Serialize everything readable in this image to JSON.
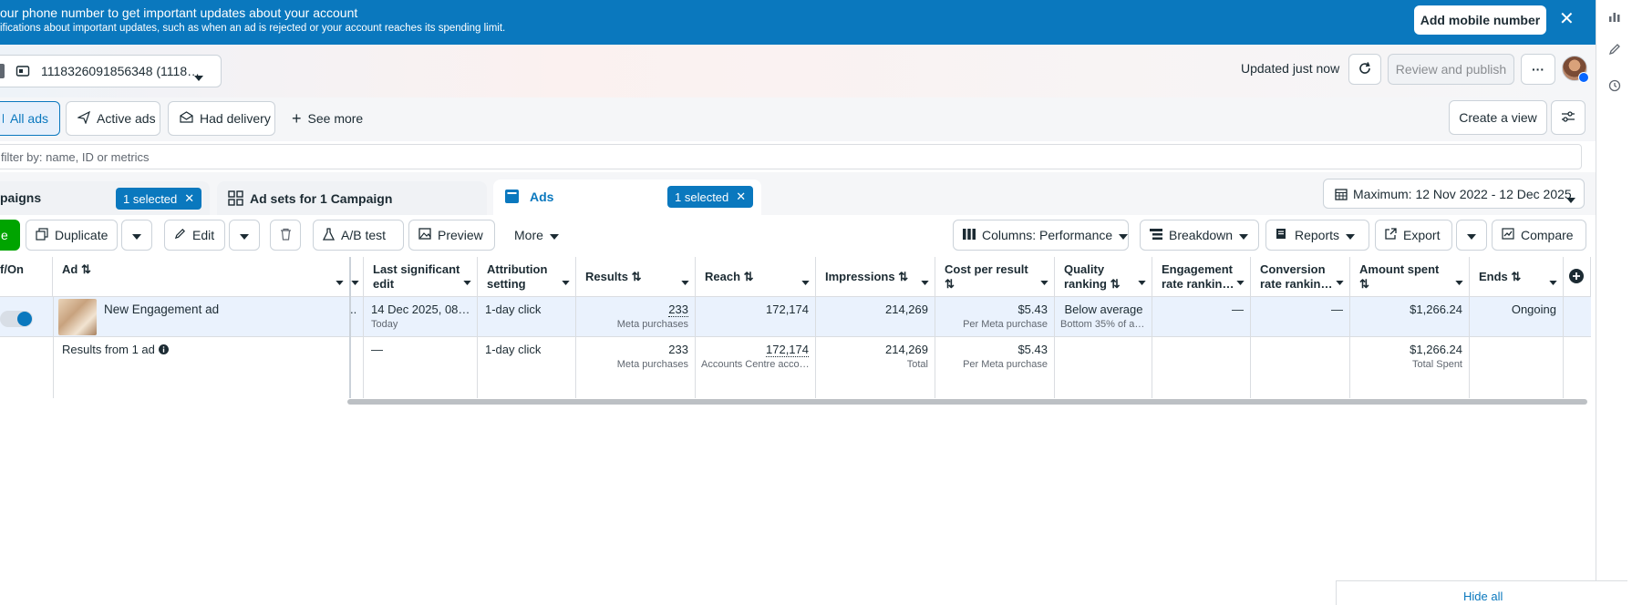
{
  "banner": {
    "line1": "our phone number to get important updates about your account",
    "line2": "ifications about important updates, such as when an ad is rejected or your account reaches its spending limit.",
    "add_button": "Add mobile number",
    "close": "✕"
  },
  "header": {
    "account": "1118326091856348 (1118…",
    "updated": "Updated just now",
    "review_publish": "Review and publish",
    "more": "···"
  },
  "filters": {
    "all_ads": "All ads",
    "active_ads": "Active ads",
    "had_delivery": "Had delivery",
    "see_more": "See more",
    "create_view": "Create a view"
  },
  "search": {
    "placeholder": "filter by: name, ID or metrics"
  },
  "levels": {
    "campaigns": "paigns",
    "campaigns_badge": "1 selected",
    "adsets": "Ad sets for 1 Campaign",
    "ads": "Ads",
    "ads_badge": "1 selected"
  },
  "date_range": "Maximum: 12 Nov 2022 - 12 Dec 2025",
  "toolbar": {
    "create": "e",
    "duplicate": "Duplicate",
    "edit": "Edit",
    "ab_test": "A/B test",
    "preview": "Preview",
    "more": "More",
    "columns": "Columns: Performance",
    "breakdown": "Breakdown",
    "reports": "Reports",
    "export": "Export",
    "compare": "Compare"
  },
  "columns": {
    "offon": "f/On",
    "ad": "Ad",
    "last_edit_1": "Last significant",
    "last_edit_2": "edit",
    "attribution_1": "Attribution",
    "attribution_2": "setting",
    "results": "Results",
    "reach": "Reach",
    "impressions": "Impressions",
    "cpr_1": "Cost per result",
    "quality_1": "Quality",
    "quality_2": "ranking",
    "engagement_1": "Engagement",
    "engagement_2": "rate rankin…",
    "conversion_1": "Conversion",
    "conversion_2": "rate rankin…",
    "amount_spent_1": "Amount spent",
    "ends": "Ends"
  },
  "row": {
    "ad_name": "New Engagement ad",
    "truncated": "..",
    "last_edit": "14 Dec 2025, 08…",
    "last_edit_sub": "Today",
    "attribution": "1-day click",
    "results": "233",
    "results_sub": "Meta purchases",
    "reach": "172,174",
    "impressions": "214,269",
    "cpr": "$5.43",
    "cpr_sub": "Per Meta purchase",
    "quality": "Below average",
    "quality_sub": "Bottom 35% of a…",
    "engagement": "—",
    "conversion": "—",
    "amount_spent": "$1,266.24",
    "ends": "Ongoing"
  },
  "summary": {
    "label": "Results from 1 ad",
    "last_edit": "—",
    "attribution": "1-day click",
    "results": "233",
    "results_sub": "Meta purchases",
    "reach": "172,174",
    "reach_sub": "Accounts Centre acco…",
    "impressions": "214,269",
    "impressions_sub": "Total",
    "cpr": "$5.43",
    "cpr_sub": "Per Meta purchase",
    "amount_spent": "$1,266.24",
    "amount_spent_sub": "Total Spent"
  },
  "footer": {
    "hide_all": "Hide all"
  },
  "colors": {
    "accent": "#0a78be",
    "green": "#00a400"
  }
}
